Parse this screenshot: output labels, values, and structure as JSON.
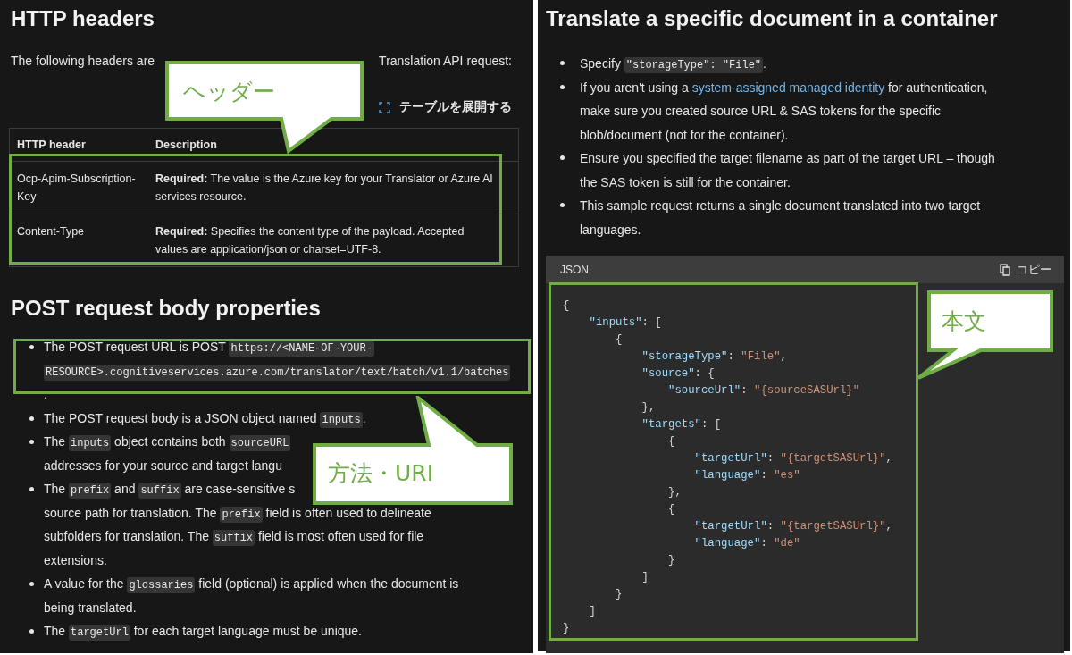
{
  "left_panel": {
    "heading": "HTTP headers",
    "intro_visible_parts": [
      "The following headers are",
      "Translation API request:"
    ],
    "expand_table_button": "テーブルを展開する",
    "table": {
      "columns": [
        "HTTP header",
        "Description"
      ],
      "rows": [
        [
          "Ocp-Apim-Subscription-Key",
          "**Required:** The value is the Azure key for your Translator or Azure AI services resource."
        ],
        [
          "Content-Type",
          "**Required:** Specifies the content type of the payload. Accepted values are application/json or charset=UTF-8."
        ]
      ]
    },
    "section_heading": "POST request body properties",
    "bullets": [
      {
        "lines": [
          [
            "The POST request URL is POST ",
            {
              "kind": "code",
              "text": "https://<NAME-OF-YOUR-"
            }
          ],
          [
            {
              "kind": "code",
              "text": "RESOURCE>.cognitiveservices.azure.com/translator/text/batch/v1.1/batches"
            }
          ],
          [
            "."
          ]
        ]
      },
      {
        "lines": [
          [
            "The POST request body is a JSON object named ",
            {
              "kind": "code",
              "text": "inputs"
            },
            "."
          ]
        ]
      },
      {
        "lines": [
          [
            "The ",
            {
              "kind": "code",
              "text": "inputs"
            },
            " object contains both ",
            {
              "kind": "code",
              "text": "sourceURL"
            }
          ],
          [
            "addresses for your source and target langu"
          ]
        ]
      },
      {
        "lines": [
          [
            "The ",
            {
              "kind": "code",
              "text": "prefix"
            },
            " and ",
            {
              "kind": "code",
              "text": "suffix"
            },
            " are case-sensitive s"
          ],
          [
            "source path for translation. The ",
            {
              "kind": "code",
              "text": "prefix"
            },
            " field is often used to delineate"
          ],
          [
            "subfolders for translation. The ",
            {
              "kind": "code",
              "text": "suffix"
            },
            " field is most often used for file"
          ],
          [
            "extensions."
          ]
        ]
      },
      {
        "lines": [
          [
            "A value for the ",
            {
              "kind": "code",
              "text": "glossaries"
            },
            " field (optional) is applied when the document is"
          ],
          [
            "being translated."
          ]
        ]
      },
      {
        "lines": [
          [
            "The ",
            {
              "kind": "code",
              "text": "targetUrl"
            },
            " for each target language must be unique."
          ]
        ]
      }
    ]
  },
  "right_panel": {
    "heading": "Translate a specific document in a container",
    "bullets": [
      {
        "lines": [
          [
            "Specify ",
            {
              "kind": "code",
              "text": "\"storageType\": \"File\""
            },
            "."
          ]
        ]
      },
      {
        "lines": [
          [
            "If you aren't using a ",
            {
              "kind": "link",
              "text": "system-assigned managed identity"
            },
            " for authentication,"
          ],
          [
            "make sure you created source URL & SAS tokens for the specific"
          ],
          [
            "blob/document (not for the container)."
          ]
        ]
      },
      {
        "lines": [
          [
            "Ensure you specified the target filename as part of the target URL – though"
          ],
          [
            "the SAS token is still for the container."
          ]
        ]
      },
      {
        "lines": [
          [
            "This sample request returns a single document translated into two target"
          ],
          [
            "languages."
          ]
        ]
      }
    ],
    "code_block": {
      "language": "JSON",
      "copy_button": "コピー",
      "lines": [
        [
          "{"
        ],
        [
          {
            "kind": "key",
            "text": "    \"inputs\""
          },
          ": ["
        ],
        [
          "        {"
        ],
        [
          {
            "kind": "key",
            "text": "            \"storageType\""
          },
          ": ",
          {
            "kind": "string",
            "text": "\"File\""
          },
          ","
        ],
        [
          {
            "kind": "key",
            "text": "            \"source\""
          },
          ": {"
        ],
        [
          {
            "kind": "key",
            "text": "                \"sourceUrl\""
          },
          ": ",
          {
            "kind": "string",
            "text": "\"{sourceSASUrl}\""
          }
        ],
        [
          "            },"
        ],
        [
          {
            "kind": "key",
            "text": "            \"targets\""
          },
          ": ["
        ],
        [
          "                {"
        ],
        [
          {
            "kind": "key",
            "text": "                    \"targetUrl\""
          },
          ": ",
          {
            "kind": "string",
            "text": "\"{targetSASUrl}\""
          },
          ","
        ],
        [
          {
            "kind": "key",
            "text": "                    \"language\""
          },
          ": ",
          {
            "kind": "string",
            "text": "\"es\""
          }
        ],
        [
          "                },"
        ],
        [
          "                {"
        ],
        [
          {
            "kind": "key",
            "text": "                    \"targetUrl\""
          },
          ": ",
          {
            "kind": "string",
            "text": "\"{targetSASUrl}\""
          },
          ","
        ],
        [
          {
            "kind": "key",
            "text": "                    \"language\""
          },
          ": ",
          {
            "kind": "string",
            "text": "\"de\""
          }
        ],
        [
          "                }"
        ],
        [
          "            ]"
        ],
        [
          "        }"
        ],
        [
          "    ]"
        ],
        [
          "}"
        ]
      ]
    }
  },
  "callouts": [
    {
      "text": "ヘッダー"
    },
    {
      "text": "方法・URI"
    },
    {
      "text": "本文"
    }
  ]
}
